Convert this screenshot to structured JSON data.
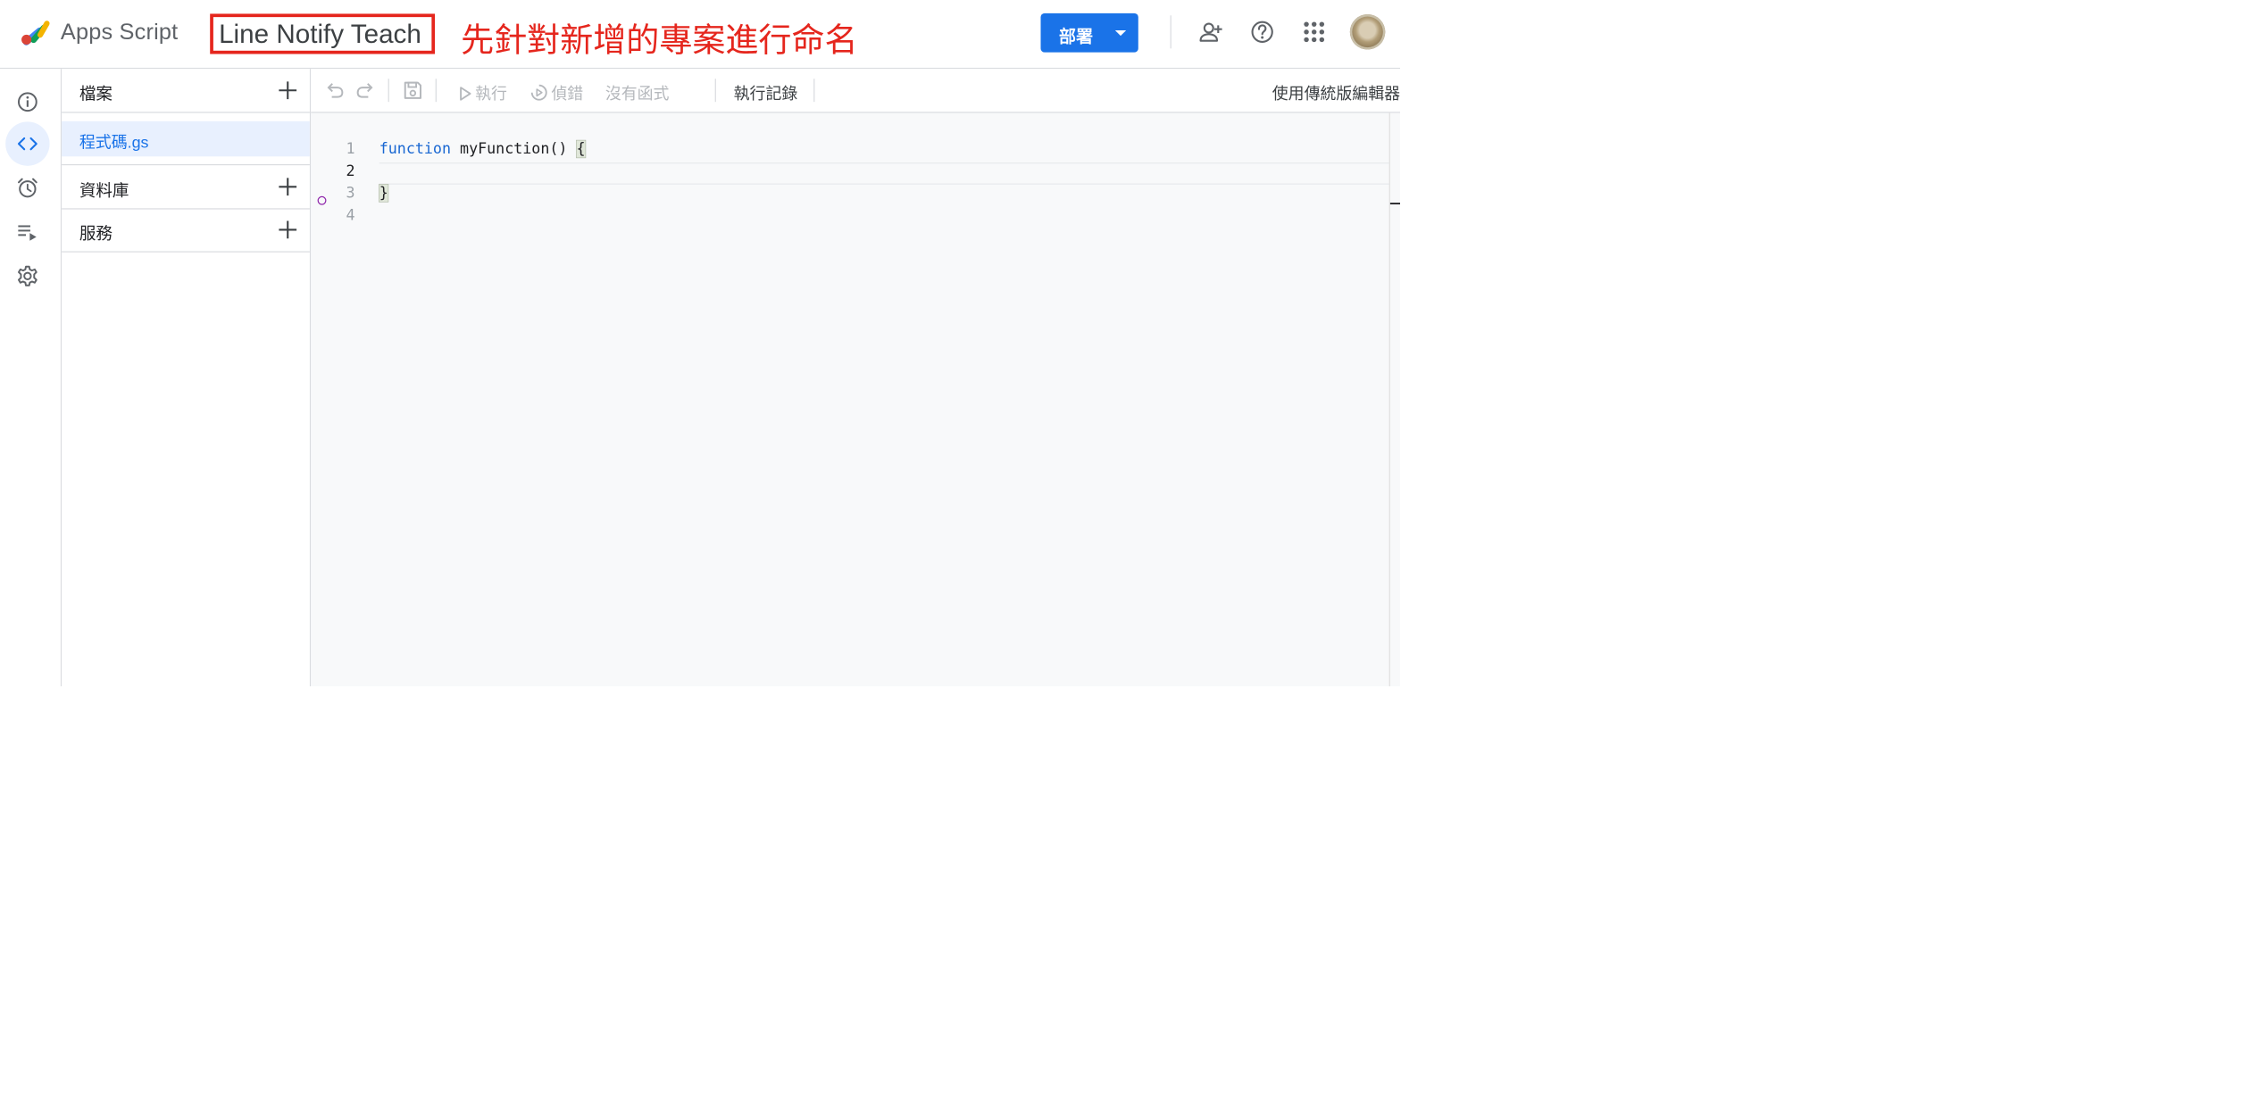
{
  "header": {
    "product_name": "Apps Script",
    "project_title": "Line Notify Teach",
    "annotation": "先針對新增的專案進行命名",
    "deploy_label": "部署",
    "icons": [
      "add-person-icon",
      "help-icon",
      "apps-grid-icon",
      "account-avatar"
    ]
  },
  "rail": {
    "items": [
      "overview-icon",
      "editor-icon",
      "triggers-icon",
      "executions-icon",
      "settings-icon"
    ],
    "active": "editor-icon"
  },
  "files_panel": {
    "files_label": "檔案",
    "file_name": "程式碼.gs",
    "libraries_label": "資料庫",
    "services_label": "服務"
  },
  "toolbar": {
    "run_label": "執行",
    "debug_label": "偵錯",
    "function_select": "沒有函式",
    "execution_log_label": "執行記錄",
    "legacy_editor_label": "使用傳統版編輯器"
  },
  "editor": {
    "line_numbers": [
      "1",
      "2",
      "3",
      "4"
    ],
    "current_line": "2",
    "code": {
      "keyword": "function",
      "rest": " myFunction() ",
      "open_brace": "{",
      "close_brace": "}"
    }
  },
  "colors": {
    "accent": "#1a73e8",
    "annotation": "#e5261d",
    "border": "#dadce0"
  }
}
